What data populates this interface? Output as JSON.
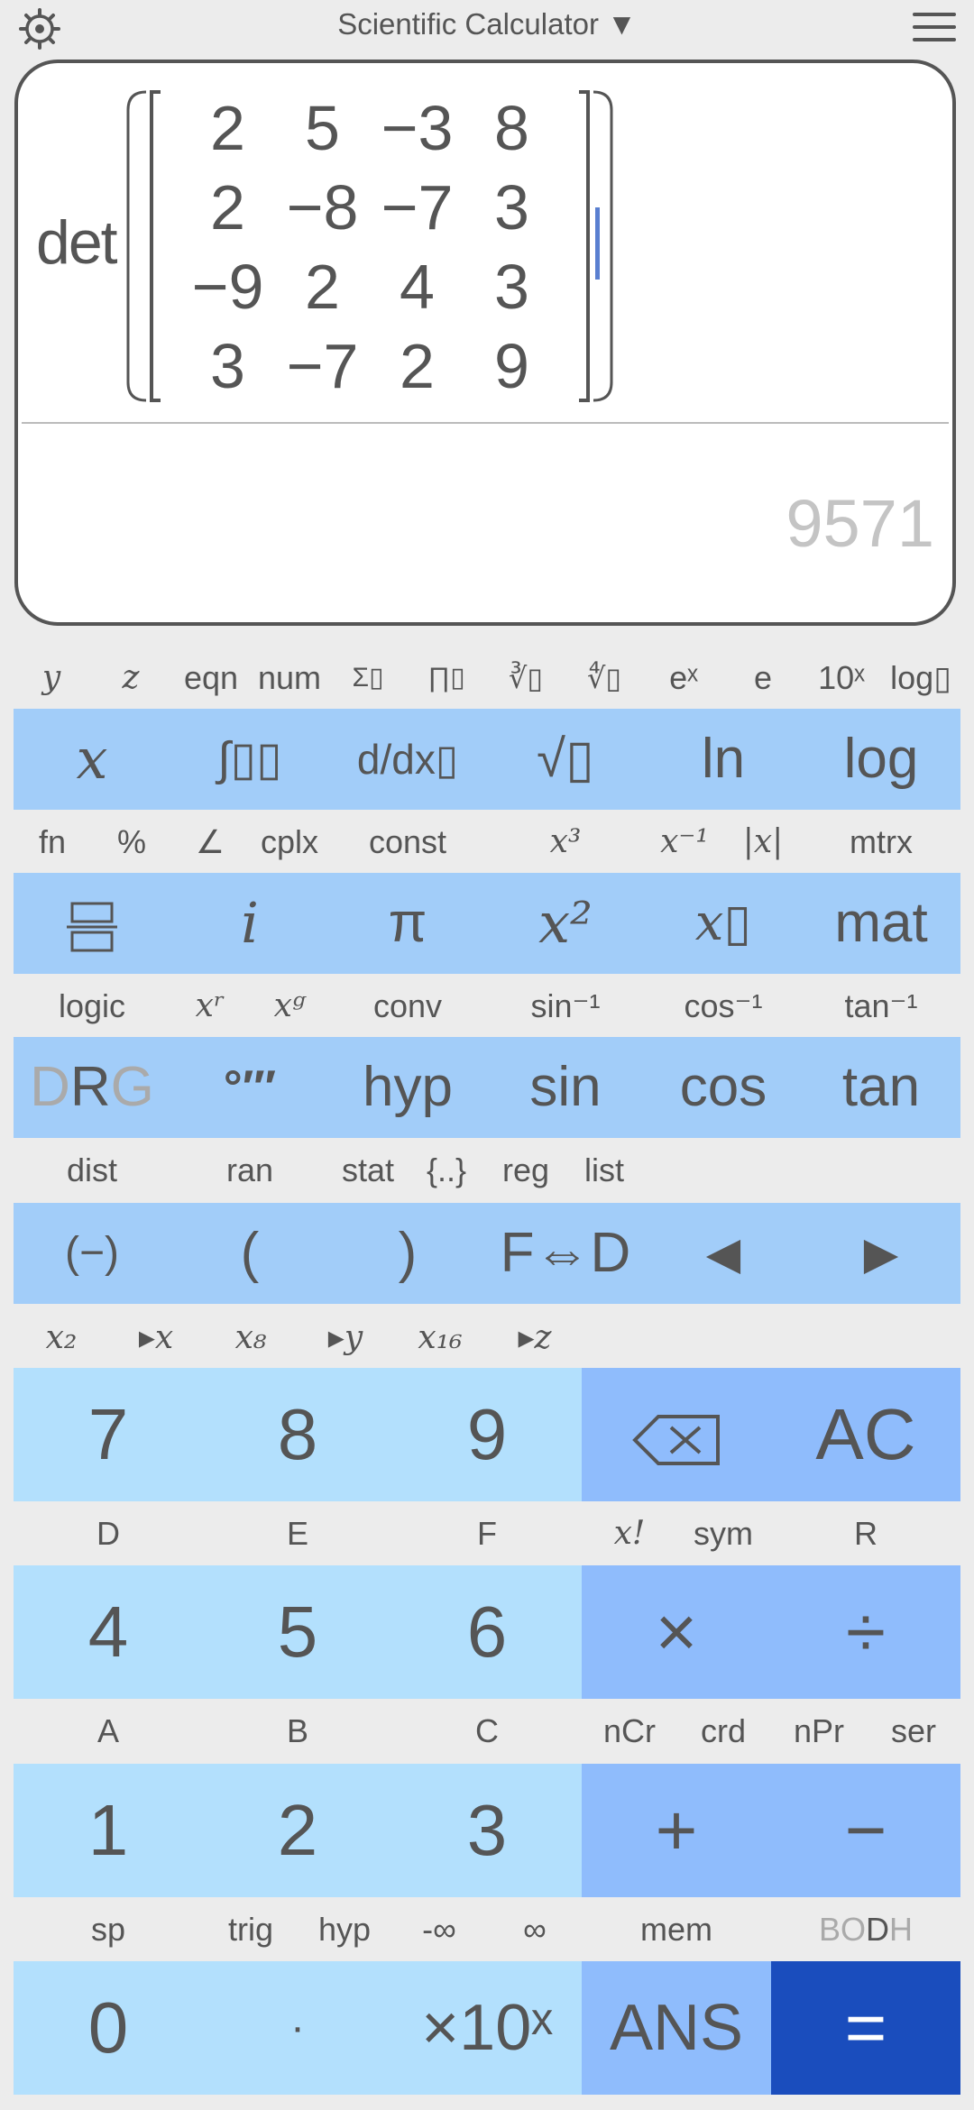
{
  "header": {
    "title": "Scientific Calculator ▼"
  },
  "display": {
    "function": "det",
    "matrix": [
      [
        "2",
        "5",
        "−3",
        "8"
      ],
      [
        "2",
        "−8",
        "−7",
        "3"
      ],
      [
        "−9",
        "2",
        "4",
        "3"
      ],
      [
        "3",
        "−7",
        "2",
        "9"
      ]
    ],
    "result": "9571"
  },
  "row1_labels": [
    "y",
    "z",
    "eqn",
    "num",
    "Σ▯",
    "∏▯",
    "∛▯",
    "∜▯",
    "eˣ",
    "e",
    "10ˣ",
    "log▯"
  ],
  "row1_keys": [
    "x",
    "∫▯▯",
    "d/dx▯",
    "√▯",
    "ln",
    "log"
  ],
  "row2_labels": [
    "fn",
    "%",
    "∠",
    "cplx",
    "const",
    "x³",
    "x⁻¹",
    "|x|",
    "mtrx"
  ],
  "row2_keys": [
    "▭",
    "i",
    "π",
    "x²",
    "x▯",
    "mat"
  ],
  "row3_labels": [
    "logic",
    "xʳ",
    "xᵍ",
    "conv",
    "sin⁻¹",
    "cos⁻¹",
    "tan⁻¹"
  ],
  "row3_keys": [
    "DRG",
    "°′″",
    "hyp",
    "sin",
    "cos",
    "tan"
  ],
  "row4_labels": [
    "dist",
    "ran",
    "stat",
    "{..}",
    "reg",
    "list"
  ],
  "row4_keys": [
    "(−)",
    "(",
    ")",
    "F⇔D",
    "◀",
    "▶"
  ],
  "row5_labels": [
    "x₂",
    "▸x",
    "x₈",
    "▸y",
    "x₁₆",
    "▸z"
  ],
  "num_rows": [
    {
      "keys": [
        "7",
        "8",
        "9",
        "⌫",
        "AC"
      ]
    },
    {
      "labels": [
        "D",
        "E",
        "F",
        "x!",
        "sym",
        "R"
      ],
      "keys": [
        "4",
        "5",
        "6",
        "×",
        "÷"
      ]
    },
    {
      "labels": [
        "A",
        "B",
        "C",
        "nCr",
        "crd",
        "nPr",
        "ser"
      ],
      "keys": [
        "1",
        "2",
        "3",
        "+",
        "−"
      ]
    },
    {
      "labels": [
        "sp",
        "trig",
        "hyp",
        "-∞",
        "∞",
        "mem",
        "BODH"
      ],
      "keys": [
        "0",
        "·",
        "×10ˣ",
        "ANS",
        "="
      ]
    }
  ],
  "drg": {
    "D": "D",
    "R": "R",
    "G": "G"
  },
  "bodh": {
    "B": "B",
    "O": "O",
    "D": "D",
    "H": "H"
  },
  "colors": {
    "key_row": "#a2cdf9",
    "num_key": "#b3e0fd",
    "op_key": "#8fbcfc",
    "equals": "#1a4dbd"
  }
}
